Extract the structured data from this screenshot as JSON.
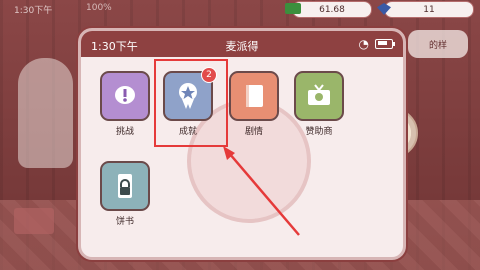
{
  "status": {
    "time": "1:30下午",
    "percent": "100%"
  },
  "currency": {
    "money": "61.68",
    "gems": "11"
  },
  "background": {
    "speech_text": "的样"
  },
  "phone": {
    "time": "1:30下午",
    "title": "麦派得",
    "apps": [
      {
        "label": "挑战",
        "color": "#b48ed1",
        "icon": "exclamation-icon"
      },
      {
        "label": "成就",
        "color": "#8fa2c9",
        "icon": "ribbon-star-icon",
        "badge": "2"
      },
      {
        "label": "剧情",
        "color": "#e88f73",
        "icon": "book-icon"
      },
      {
        "label": "赞助商",
        "color": "#9ab66a",
        "icon": "tv-icon"
      },
      {
        "label": "饼书",
        "color": "#8db2b9",
        "icon": "lock-icon"
      }
    ]
  },
  "highlight_color": "#e53a3a"
}
